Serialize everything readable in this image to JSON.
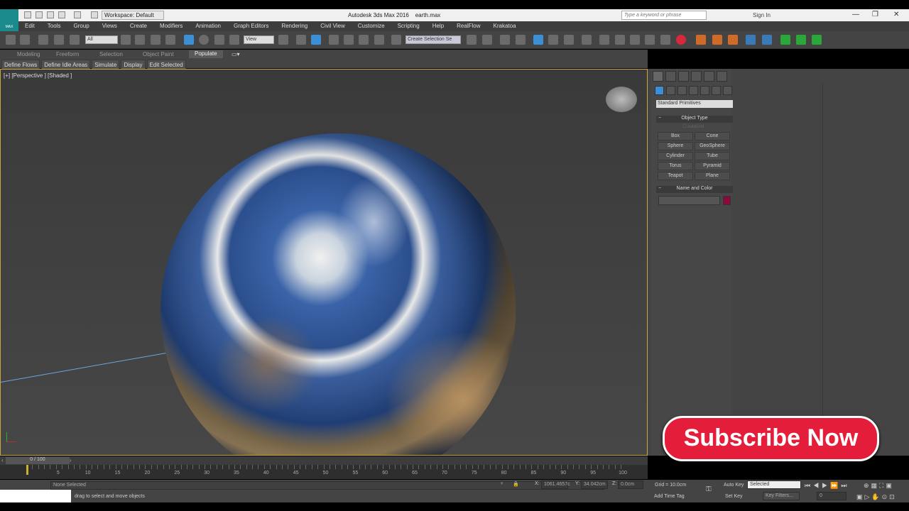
{
  "title": {
    "app": "Autodesk 3ds Max 2016",
    "file": "earth.max",
    "workspace": "Workspace: Default",
    "search_placeholder": "Type a keyword or phrase",
    "sign_in": "Sign In",
    "logo": "MAX"
  },
  "menu": [
    "Edit",
    "Tools",
    "Group",
    "Views",
    "Create",
    "Modifiers",
    "Animation",
    "Graph Editors",
    "Rendering",
    "Civil View",
    "Customize",
    "Scripting",
    "Help",
    "RealFlow",
    "Krakatoa"
  ],
  "toolbar": {
    "selection_filter": "All",
    "ref_coord": "View",
    "named_selection": "Create Selection Se"
  },
  "ribbon": {
    "tabs": [
      "Modeling",
      "Freeform",
      "Selection",
      "Object Paint",
      "Populate"
    ],
    "active_tab": "Populate",
    "panel_buttons": [
      "Define Flows",
      "Define Idle Areas",
      "Simulate",
      "Display",
      "Edit Selected"
    ]
  },
  "viewport": {
    "label": "[+] [Perspective ] [Shaded ]"
  },
  "command_panel": {
    "category": "Standard Primitives",
    "object_type_header": "Object Type",
    "autogrid": "AutoGrid",
    "primitives": [
      "Box",
      "Cone",
      "Sphere",
      "GeoSphere",
      "Cylinder",
      "Tube",
      "Torus",
      "Pyramid",
      "Teapot",
      "Plane"
    ],
    "name_color_header": "Name and Color",
    "object_color": "#8b0a3c"
  },
  "overlay": {
    "subscribe": "Subscribe Now",
    "color": "#e41e3a"
  },
  "timeline": {
    "slider": "0 / 100",
    "labels": [
      "5",
      "10",
      "15",
      "20",
      "25",
      "30",
      "35",
      "40",
      "45",
      "50",
      "55",
      "60",
      "65",
      "70",
      "75",
      "80",
      "85",
      "90",
      "95",
      "100"
    ]
  },
  "status": {
    "selection": "None Selected",
    "prompt": "drag to select and move objects",
    "x": "1061.4657c",
    "y": "34.042cm",
    "z": "0.0cm",
    "x_label": "X:",
    "y_label": "Y:",
    "z_label": "Z:",
    "grid": "Grid = 10.0cm",
    "add_time_tag": "Add Time Tag",
    "auto_key": "Auto Key",
    "set_key": "Set Key",
    "key_mode": "Selected",
    "key_filters": "Key Filters...",
    "frame": "0"
  }
}
